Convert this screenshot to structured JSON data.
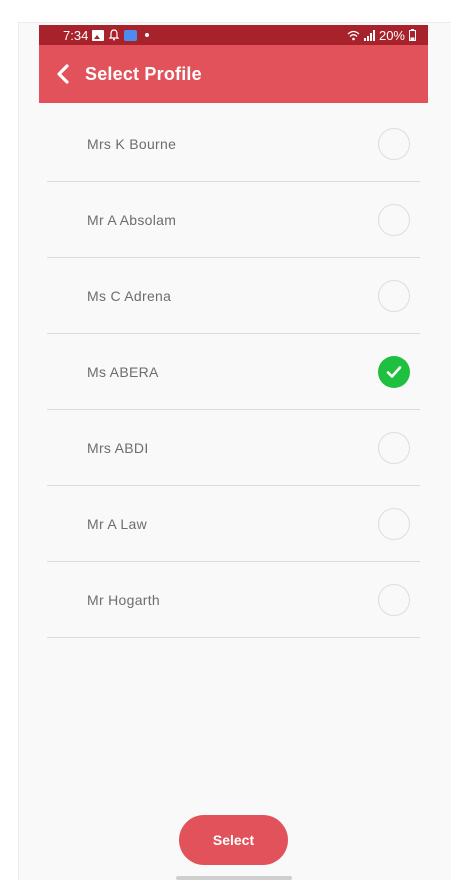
{
  "status_bar": {
    "time": "7:34",
    "battery": "20%"
  },
  "app_bar": {
    "title": "Select Profile"
  },
  "profiles": [
    {
      "name": "Mrs K Bourne",
      "selected": false
    },
    {
      "name": "Mr A Absolam",
      "selected": false
    },
    {
      "name": "Ms C Adrena",
      "selected": false
    },
    {
      "name": "Ms ABERA",
      "selected": true
    },
    {
      "name": "Mrs ABDI",
      "selected": false
    },
    {
      "name": "Mr A Law",
      "selected": false
    },
    {
      "name": "Mr Hogarth",
      "selected": false
    }
  ],
  "footer": {
    "select_label": "Select"
  },
  "colors": {
    "status_bar": "#a8222b",
    "app_bar": "#e2525a",
    "button": "#e2525a",
    "check": "#1fbf3f",
    "background": "#f9f9f9"
  },
  "icons": {
    "back": "chevron-left-icon",
    "check": "check-icon",
    "wifi": "wifi-icon",
    "signal": "signal-icon",
    "battery": "battery-icon"
  }
}
